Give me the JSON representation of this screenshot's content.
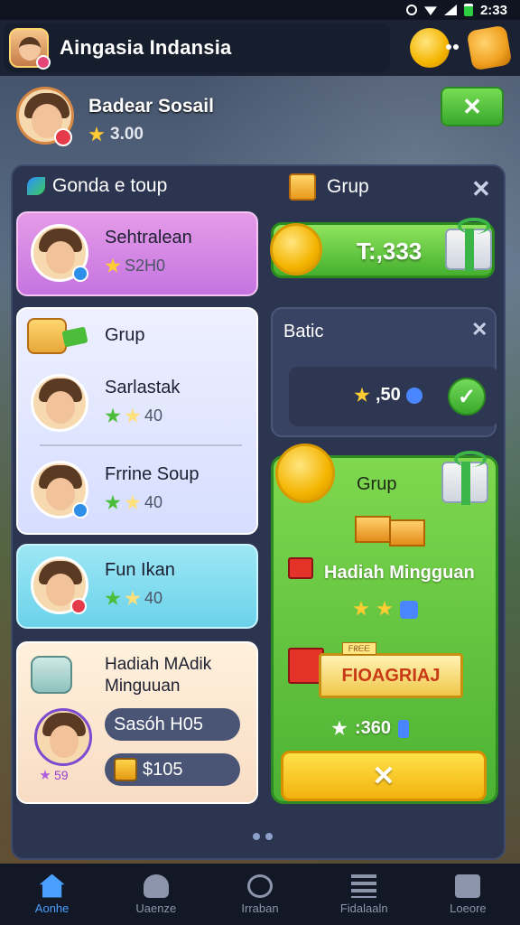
{
  "status_bar": {
    "time": "2:33"
  },
  "header": {
    "title": "Aingasia Indansia"
  },
  "profile": {
    "name": "Badear Sosail",
    "rating": "3.00"
  },
  "panel": {
    "left_title": "Gonda e toup",
    "right_title": "Grup",
    "cards": {
      "pink": {
        "name": "Sehtralean",
        "rating": "S2H0"
      },
      "group": {
        "title": "Grup",
        "members": [
          {
            "name": "Sarlastak",
            "rating": "40"
          },
          {
            "name": "Frrine Soup",
            "rating": "40"
          }
        ]
      },
      "cyan": {
        "name": "Fun Ikan",
        "rating": "40"
      },
      "peach": {
        "title": "Hadiah MAdik Minguuan",
        "badge": "59",
        "pill1": "Sasóh H05",
        "pill2": "$105"
      }
    },
    "reward_bar": {
      "value": "T:,333"
    },
    "batic": {
      "title": "Batic",
      "value": ",50"
    },
    "weekly": {
      "title": "Grup",
      "subtitle": "Hadiah Mingguan",
      "ribbon": "FIOAGRIAJ",
      "ribbon_tag": "ᖴᖇᗴᗴ",
      "value": ":360"
    }
  },
  "nav": {
    "items": [
      {
        "label": "Aonhe"
      },
      {
        "label": "Uaenze"
      },
      {
        "label": "Irraban"
      },
      {
        "label": "Fidalaaln"
      },
      {
        "label": "Loeore"
      }
    ]
  },
  "colors": {
    "accent": "#4aa0ff",
    "green": "#45b02e",
    "gold": "#f4b400"
  }
}
